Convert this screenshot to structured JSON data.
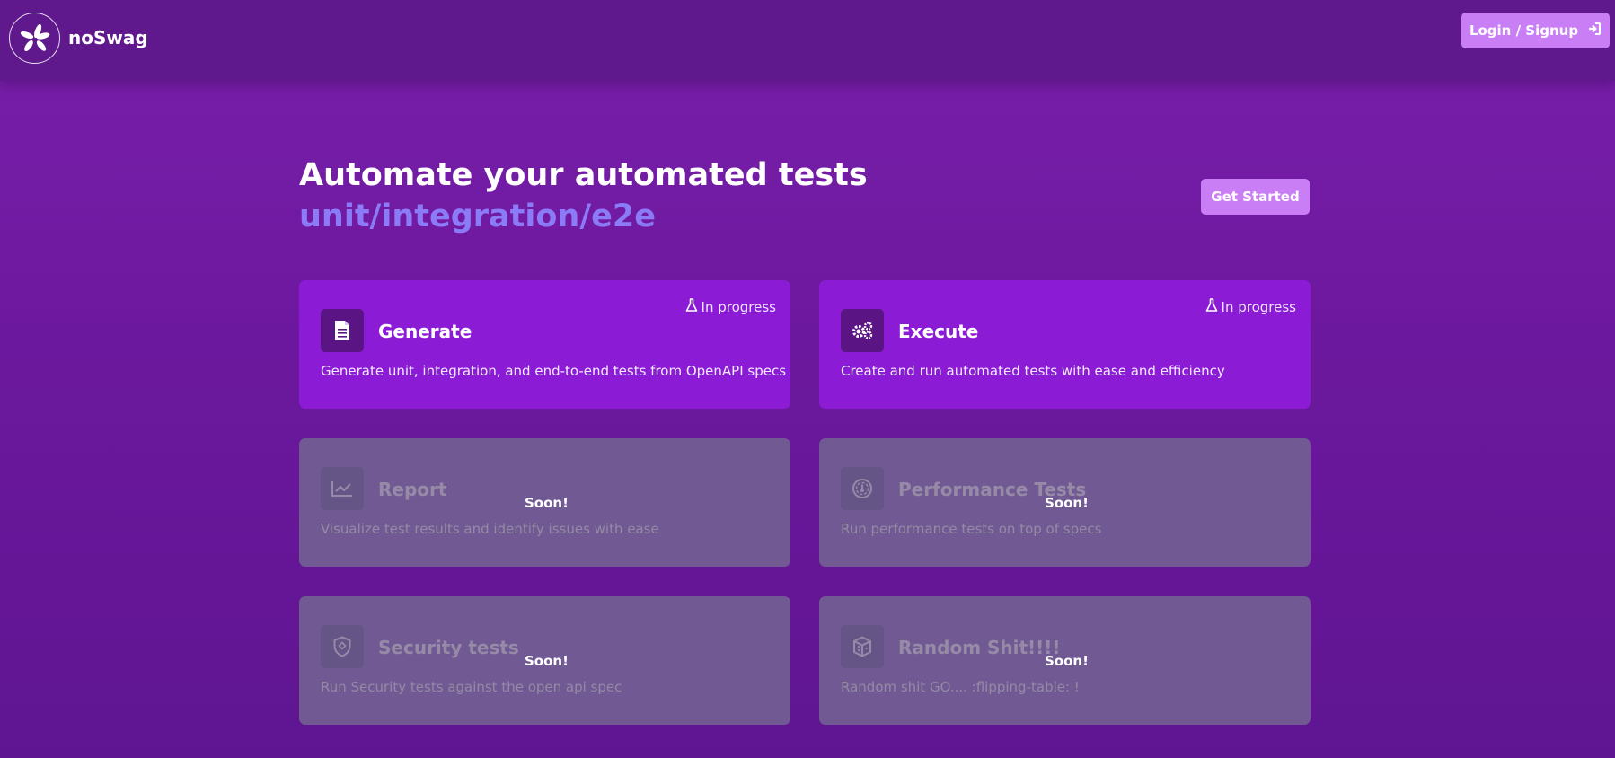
{
  "header": {
    "brand": "noSwag",
    "login_label": "Login / Signup",
    "logo_icon": "flower-logo-icon",
    "login_icon": "sign-in-icon"
  },
  "hero": {
    "title": "Automate your automated tests",
    "subtitle": "unit/integration/e2e",
    "cta_label": "Get Started"
  },
  "cards": [
    {
      "title": "Generate",
      "description": "Generate unit, integration, and end-to-end tests from OpenAPI specs",
      "status": "In progress",
      "icon": "document-icon",
      "state": "active"
    },
    {
      "title": "Execute",
      "description": "Create and run automated tests with ease and efficiency",
      "status": "In progress",
      "icon": "gears-icon",
      "state": "active"
    },
    {
      "title": "Report",
      "description": "Visualize test results and identify issues with ease",
      "status": "Soon!",
      "icon": "chart-line-icon",
      "state": "disabled"
    },
    {
      "title": "Performance Tests",
      "description": "Run performance tests on top of specs",
      "status": "Soon!",
      "icon": "gauge-icon",
      "state": "disabled"
    },
    {
      "title": "Security tests",
      "description": "Run Security tests against the open api spec",
      "status": "Soon!",
      "icon": "shield-icon",
      "state": "disabled"
    },
    {
      "title": "Random Shit!!!!",
      "description": "Random shit GO.... :flipping-table: !",
      "status": "Soon!",
      "icon": "cube-icon",
      "state": "disabled"
    }
  ],
  "colors": {
    "background": "#6c189e",
    "header": "#5f198c",
    "accent_button": "#c97ef5",
    "active_card": "#8b1bd4",
    "disabled_card": "#715a93",
    "subtitle": "#8c7bf6"
  }
}
